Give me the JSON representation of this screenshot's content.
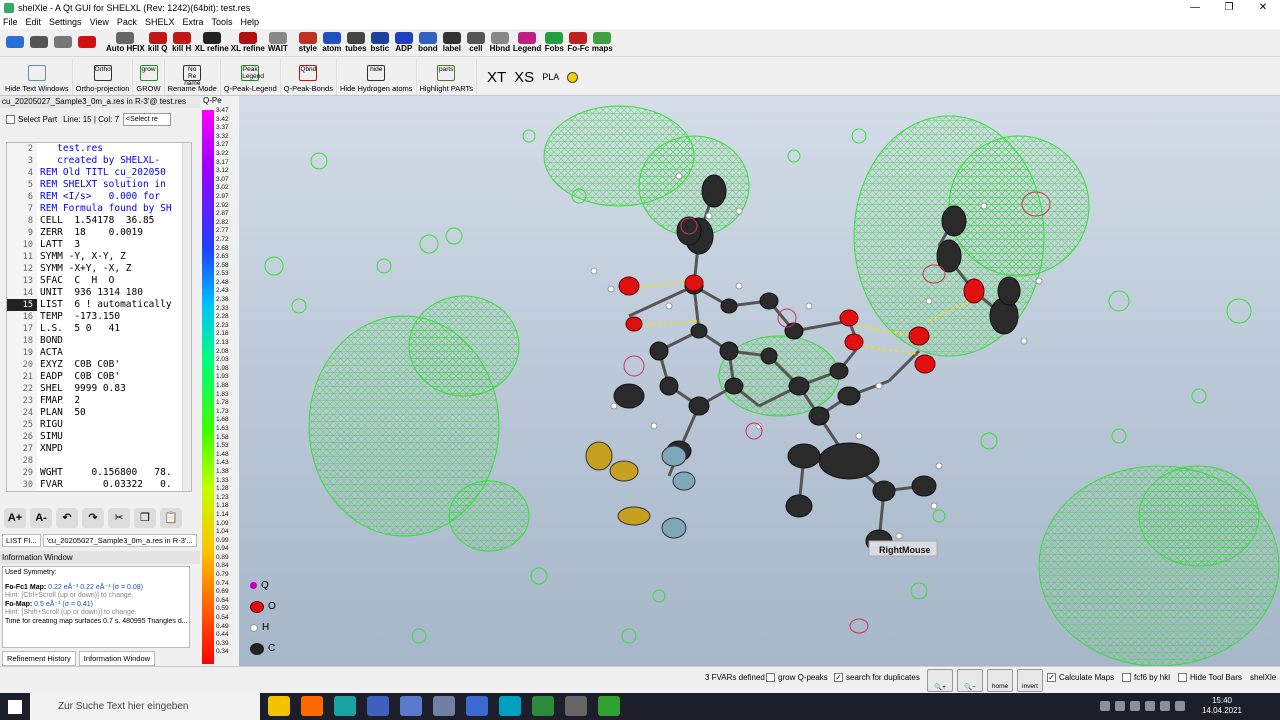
{
  "window": {
    "title": "shelXle - A Qt GUI for SHELXL (Rev: 1242)(64bit): test.res",
    "controls": [
      "—",
      "❐",
      "✕"
    ]
  },
  "menu": [
    "File",
    "Edit",
    "Settings",
    "View",
    "Pack",
    "SHELX",
    "Extra",
    "Tools",
    "Help"
  ],
  "toolbar1": [
    {
      "label": "",
      "icon": "open-res-icon",
      "color": "#2a6fd6"
    },
    {
      "label": "",
      "icon": "save-icon",
      "color": "#555"
    },
    {
      "label": "",
      "icon": "save-as-icon",
      "color": "#777"
    },
    {
      "label": "",
      "icon": "stop-icon",
      "color": "#d01010"
    },
    {
      "label": "Auto HFIX",
      "icon": "auto-hfix-icon",
      "color": "#666"
    },
    {
      "label": "kill Q",
      "icon": "kill-q-icon",
      "color": "#c01818"
    },
    {
      "label": "kill H",
      "icon": "kill-h-icon",
      "color": "#c01818"
    },
    {
      "label": "XL refine",
      "icon": "xl-refine-icon",
      "color": "#222"
    },
    {
      "label": "XL refine",
      "icon": "xl-refine-stop-icon",
      "color": "#b01010"
    },
    {
      "label": "WAIT",
      "icon": "wait-icon",
      "color": "#888"
    },
    {
      "label": "style",
      "icon": "style-icon",
      "color": "#c03020"
    },
    {
      "label": "atom",
      "icon": "atom-icon",
      "color": "#2050c0"
    },
    {
      "label": "tubes",
      "icon": "tubes-icon",
      "color": "#444"
    },
    {
      "label": "bstic",
      "icon": "ball-stick-icon",
      "color": "#2040a0"
    },
    {
      "label": "ADP",
      "icon": "adp-icon",
      "color": "#2040c0"
    },
    {
      "label": "bond",
      "icon": "bond-icon",
      "color": "#3060c0"
    },
    {
      "label": "label",
      "icon": "label-icon",
      "color": "#333"
    },
    {
      "label": "cell",
      "icon": "cell-icon",
      "color": "#555"
    },
    {
      "label": "Hbnd",
      "icon": "hbond-icon",
      "color": "#888"
    },
    {
      "label": "Legend",
      "icon": "legend-icon",
      "color": "#c02080"
    },
    {
      "label": "Fobs",
      "icon": "fobs-icon",
      "color": "#20a040"
    },
    {
      "label": "Fo-Fc",
      "icon": "fo-fc-icon",
      "color": "#c02020"
    },
    {
      "label": "maps",
      "icon": "maps-icon",
      "color": "#40a040"
    }
  ],
  "toolbar2": [
    {
      "label": "Hide Text Windows",
      "icon": "hide-text-icon"
    },
    {
      "label": "Ortho-projection",
      "icon": "ortho-icon"
    },
    {
      "label": "GROW",
      "icon": "grow-icon"
    },
    {
      "label": "Rename Mode",
      "icon": "rename-icon"
    },
    {
      "label": "Q-Peak-Legend",
      "icon": "q-peak-legend-icon"
    },
    {
      "label": "Q-Peak-Bonds",
      "icon": "q-peak-bonds-icon"
    },
    {
      "label": "Hide Hydrogen atoms",
      "icon": "hide-hydrogen-icon"
    },
    {
      "label": "Highlight PARTs",
      "icon": "parts-icon"
    }
  ],
  "toolbar2_small": [
    "Ortho",
    "grow",
    "No Re name",
    "Peak Legend",
    "Qbnd",
    "hide",
    "parts"
  ],
  "xtxs": [
    "XT",
    "XS",
    "PLA"
  ],
  "left_panel": {
    "file_tab": "cu_20205027_Sample3_0m_a.res in R-3'@ test.res",
    "select_part": "Select Part",
    "line_info": "Line: 15 | Col: 7",
    "select_res": "<Select re",
    "lines": [
      {
        "n": "2",
        "t": "   test.res",
        "c": "rem"
      },
      {
        "n": "3",
        "t": "   created by SHELXL-",
        "c": "rem"
      },
      {
        "n": "4",
        "t": "REM Old TITL cu_202050",
        "c": "rem"
      },
      {
        "n": "5",
        "t": "REM SHELXT solution in",
        "c": "rem"
      },
      {
        "n": "6",
        "t": "REM <I/s>   0.000 for",
        "c": "rem"
      },
      {
        "n": "7",
        "t": "REM Formula found by SH",
        "c": "rem"
      },
      {
        "n": "8",
        "t": "CELL  1.54178  36.85",
        "c": "kw"
      },
      {
        "n": "9",
        "t": "ZERR  18    0.0019",
        "c": "kw"
      },
      {
        "n": "10",
        "t": "LATT  3",
        "c": "kw"
      },
      {
        "n": "11",
        "t": "SYMM -Y, X-Y, Z",
        "c": "kw"
      },
      {
        "n": "12",
        "t": "SYMM -X+Y, -X, Z",
        "c": "kw"
      },
      {
        "n": "13",
        "t": "SFAC  C  H  O",
        "c": "kw"
      },
      {
        "n": "14",
        "t": "UNIT  936 1314 180",
        "c": "kw"
      },
      {
        "n": "15",
        "t": "LIST  6 ! automatically",
        "c": "kw",
        "cur": true
      },
      {
        "n": "16",
        "t": "TEMP  -173.150",
        "c": "kw"
      },
      {
        "n": "17",
        "t": "L.S.  5 0   41",
        "c": "kw"
      },
      {
        "n": "18",
        "t": "BOND",
        "c": "kw"
      },
      {
        "n": "19",
        "t": "ACTA",
        "c": "kw"
      },
      {
        "n": "20",
        "t": "EXYZ  C0B C0B'",
        "c": "kw"
      },
      {
        "n": "21",
        "t": "EADP  C0B C0B'",
        "c": "kw"
      },
      {
        "n": "22",
        "t": "SHEL  9999 0.83",
        "c": "kw"
      },
      {
        "n": "23",
        "t": "FMAP  2",
        "c": "kw"
      },
      {
        "n": "24",
        "t": "PLAN  50",
        "c": "kw"
      },
      {
        "n": "25",
        "t": "RIGU",
        "c": "kw"
      },
      {
        "n": "26",
        "t": "SIMU",
        "c": "kw"
      },
      {
        "n": "27",
        "t": "XNPD",
        "c": "kw"
      },
      {
        "n": "28",
        "t": "",
        "c": "kw"
      },
      {
        "n": "29",
        "t": "WGHT     0.156800   78.",
        "c": "kw"
      },
      {
        "n": "30",
        "t": "FVAR       0.03322   0.",
        "c": "kw"
      }
    ],
    "tool_icons": [
      "A+",
      "A-"
    ],
    "tabs": [
      "LIST FI...",
      "'cu_20205027_Sample3_0m_a.res in R-3'..."
    ]
  },
  "qpeak": {
    "title": "Q-Pe",
    "labels": [
      "3.47",
      "3.42",
      "3.37",
      "3.32",
      "3.27",
      "3.22",
      "3.17",
      "3.12",
      "3.07",
      "3.02",
      "2.97",
      "2.92",
      "2.87",
      "2.82",
      "2.77",
      "2.72",
      "2.68",
      "2.63",
      "2.58",
      "2.53",
      "2.48",
      "2.43",
      "2.38",
      "2.33",
      "2.28",
      "2.23",
      "2.18",
      "2.13",
      "2.08",
      "2.03",
      "1.98",
      "1.93",
      "1.88",
      "1.83",
      "1.78",
      "1.73",
      "1.68",
      "1.63",
      "1.58",
      "1.53",
      "1.48",
      "1.43",
      "1.38",
      "1.33",
      "1.28",
      "1.23",
      "1.18",
      "1.14",
      "1.09",
      "1.04",
      "0.99",
      "0.94",
      "0.89",
      "0.84",
      "0.79",
      "0.74",
      "0.69",
      "0.64",
      "0.59",
      "0.54",
      "0.49",
      "0.44",
      "0.39",
      "0.34"
    ]
  },
  "info_window": {
    "title": "Information Window",
    "used_symmetry": "Used Symmetry:",
    "fofc_label": "Fo-Fc1 Map:",
    "fofc_value": " 0.22 eÅ⁻³  0.22 eÅ⁻³ (σ = 0.08)",
    "fofc_hint": "Hint: [Ctrl+Scroll (up or down)] to change.",
    "fo_label": "Fo-Map:",
    "fo_value": " 0.5 eÅ⁻³ (σ = 0.41)",
    "fo_hint": "Hint: [Shift+Scroll (up or down)] to change.",
    "time_text": "Time for creating map surfaces 0.7 s. 480995 Triangles d...",
    "tabs": [
      "Refinement History",
      "Information Window"
    ]
  },
  "viewport": {
    "tooltip": "RightMouse",
    "legend": [
      {
        "label": "Q",
        "color": "#c000c0"
      },
      {
        "label": "O",
        "color": "#e01010"
      },
      {
        "label": "H",
        "color": "#ffffff"
      },
      {
        "label": "C",
        "color": "#222222"
      }
    ]
  },
  "statusbar": {
    "fvars": "3 FVARs defined",
    "grow_qpeaks": "grow Q-peaks",
    "search_duplicates": "search for duplicates",
    "home": "home",
    "invert": "invert",
    "calc_maps": "Calculate Maps",
    "fcf6": "fcf6 by hkl",
    "hide_toolbars": "Hide Tool Bars",
    "app": "shelXle"
  },
  "taskbar": {
    "search_placeholder": "Zur Suche Text hier eingeben",
    "time": "15:40",
    "date": "14.04.2021"
  }
}
